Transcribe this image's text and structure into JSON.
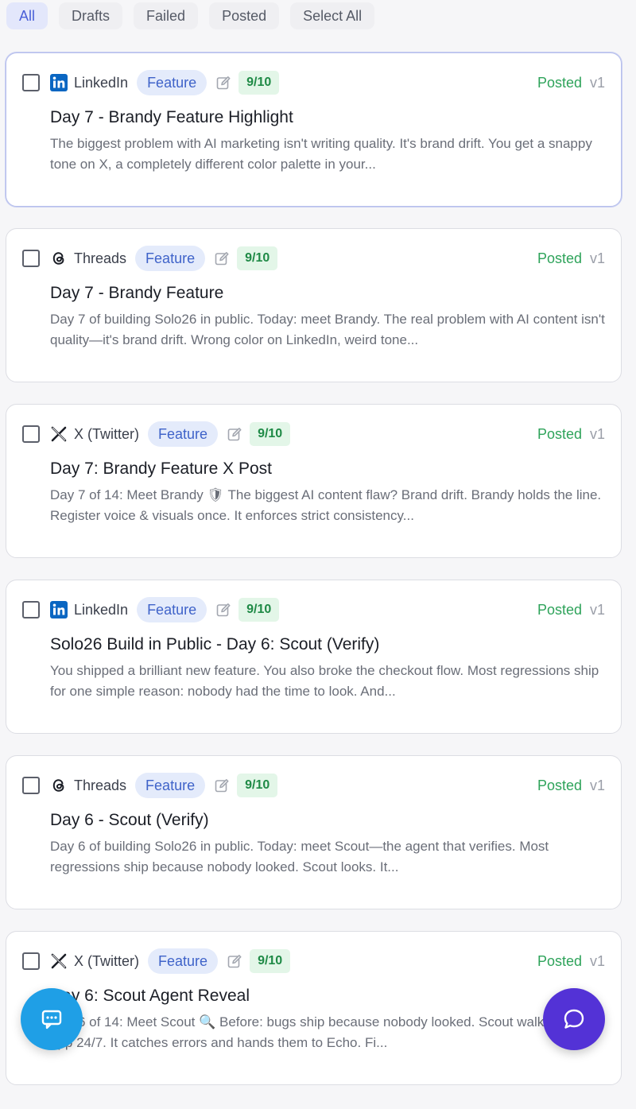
{
  "filters": [
    {
      "label": "All",
      "active": true
    },
    {
      "label": "Drafts",
      "active": false
    },
    {
      "label": "Failed",
      "active": false
    },
    {
      "label": "Posted",
      "active": false
    },
    {
      "label": "Select All",
      "active": false
    }
  ],
  "posts": [
    {
      "platform": "LinkedIn",
      "platform_icon": "linkedin-icon",
      "tag": "Feature",
      "score": "9/10",
      "status": "Posted",
      "version": "v1",
      "title": "Day 7 - Brandy Feature Highlight",
      "excerpt": "The biggest problem with AI marketing isn't writing quality. It's brand drift. You get a snappy tone on X, a completely different color palette in your..."
    },
    {
      "platform": "Threads",
      "platform_icon": "threads-icon",
      "tag": "Feature",
      "score": "9/10",
      "status": "Posted",
      "version": "v1",
      "title": "Day 7 - Brandy Feature",
      "excerpt": "Day 7 of building Solo26 in public. Today: meet Brandy. The real problem with AI content isn't quality—it's brand drift. Wrong color on LinkedIn, weird tone..."
    },
    {
      "platform": "X (Twitter)",
      "platform_icon": "x-icon",
      "tag": "Feature",
      "score": "9/10",
      "status": "Posted",
      "version": "v1",
      "title": "Day 7: Brandy Feature X Post",
      "excerpt": "Day 7 of 14: Meet Brandy 🛡 The biggest AI content flaw? Brand drift. Brandy holds the line. Register voice & visuals once. It enforces strict consistency..."
    },
    {
      "platform": "LinkedIn",
      "platform_icon": "linkedin-icon",
      "tag": "Feature",
      "score": "9/10",
      "status": "Posted",
      "version": "v1",
      "title": "Solo26 Build in Public - Day 6: Scout (Verify)",
      "excerpt": "You shipped a brilliant new feature. You also broke the checkout flow. Most regressions ship for one simple reason: nobody had the time to look. And..."
    },
    {
      "platform": "Threads",
      "platform_icon": "threads-icon",
      "tag": "Feature",
      "score": "9/10",
      "status": "Posted",
      "version": "v1",
      "title": "Day 6 - Scout (Verify)",
      "excerpt": "Day 6 of building Solo26 in public. Today: meet Scout—the agent that verifies. Most regressions ship because nobody looked. Scout looks. It..."
    },
    {
      "platform": "X (Twitter)",
      "platform_icon": "x-icon",
      "tag": "Feature",
      "score": "9/10",
      "status": "Posted",
      "version": "v1",
      "title": "Day 6: Scout Agent Reveal",
      "excerpt": "Day 6 of 14: Meet Scout 🔍 Before: bugs ship because nobody looked. Scout walks the live app 24/7. It catches errors and hands them to Echo. Fi..."
    }
  ],
  "colors": {
    "accent": "#4a5fd8",
    "posted_green": "#2ea35a",
    "tag_blue": "#3f63c9",
    "fab_left": "#1f9fe6",
    "fab_right": "#5332d6"
  },
  "fabs": {
    "left_icon": "feedback-chat-icon",
    "right_icon": "chat-bubble-icon"
  }
}
